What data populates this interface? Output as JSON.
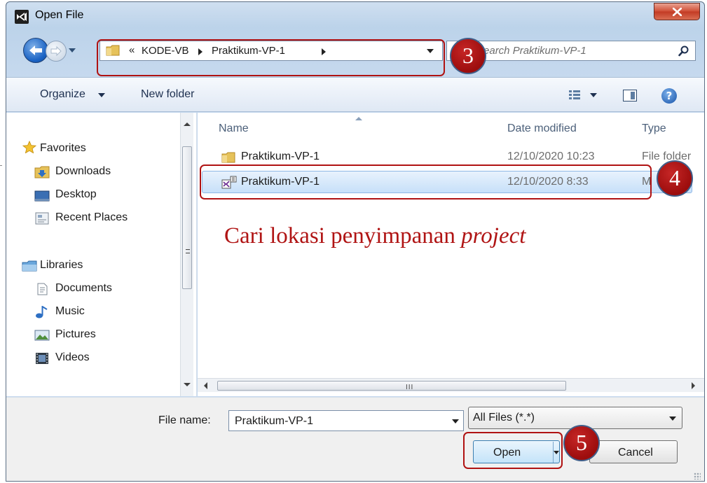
{
  "window": {
    "title": "Open File",
    "close_label": "x"
  },
  "navigation": {
    "address_chevron": "«",
    "breadcrumbs": [
      "KODE-VB",
      "Praktikum-VP-1"
    ],
    "search_placeholder": "Search Praktikum-VP-1"
  },
  "toolbar": {
    "organize_label": "Organize",
    "new_folder_label": "New folder",
    "help_label": "?"
  },
  "nav_pane": {
    "favorites_header": "Favorites",
    "favorites": [
      "Downloads",
      "Desktop",
      "Recent Places"
    ],
    "libraries_header": "Libraries",
    "libraries": [
      "Documents",
      "Music",
      "Pictures",
      "Videos"
    ]
  },
  "file_list": {
    "columns": [
      "Name",
      "Date modified",
      "Type"
    ],
    "rows": [
      {
        "name": "Praktikum-VP-1",
        "date": "12/10/2020 10:23",
        "type": "File folder",
        "icon": "folder-icon"
      },
      {
        "name": "Praktikum-VP-1",
        "date": "12/10/2020 8:33",
        "type": "M",
        "icon": "vs-solution-icon",
        "selected": true
      }
    ],
    "hscroll_grip": "III"
  },
  "bottom": {
    "file_name_label": "File name:",
    "file_name_value": "Praktikum-VP-1",
    "filter_value": "All Files (*.*)",
    "open_label": "Open",
    "cancel_label": "Cancel"
  },
  "annotations": {
    "step_3": "3",
    "step_4": "4",
    "step_5": "5",
    "caption_plain": "Cari lokasi penyimpanan ",
    "caption_italic": "project",
    "color": "#b01212"
  }
}
